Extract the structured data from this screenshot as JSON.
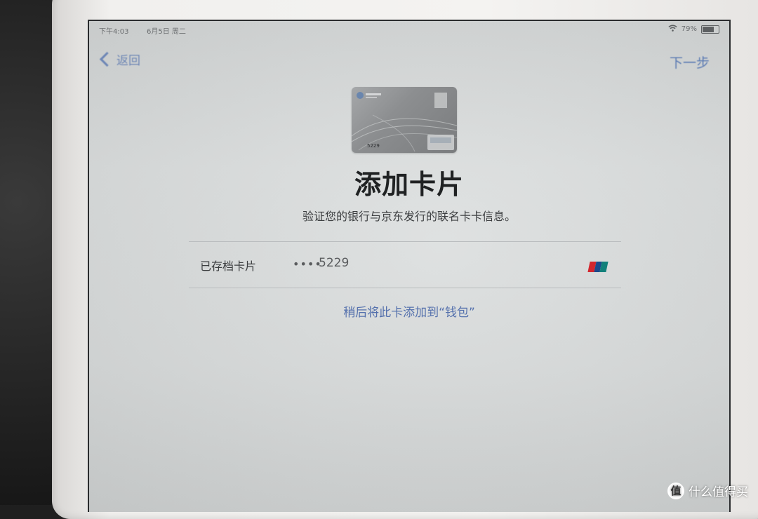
{
  "status_bar": {
    "time": "下午4:03",
    "date": "6月5日 周二",
    "battery": "79%",
    "battery_level": 0.79,
    "icons": [
      "wifi-icon",
      "battery-icon"
    ]
  },
  "nav": {
    "back_label": "返回",
    "next_label": "下一步"
  },
  "page": {
    "title": "添加卡片",
    "subtitle": "验证您的银行与京东发行的联名卡卡信息。"
  },
  "card_row": {
    "label": "已存档卡片",
    "dots": "••••",
    "number": "5229",
    "network_icon": "unionpay-icon"
  },
  "card_art": {
    "number": "5229"
  },
  "later_link": "稍后将此卡添加到“钱包”",
  "watermark": {
    "icon": "值",
    "text": "什么值得买"
  },
  "colors": {
    "accent": "#5571ad",
    "background": "#d8dbdb",
    "unionpay_red": "#d3262e",
    "unionpay_blue": "#1b4a8c",
    "unionpay_teal": "#12807a"
  }
}
